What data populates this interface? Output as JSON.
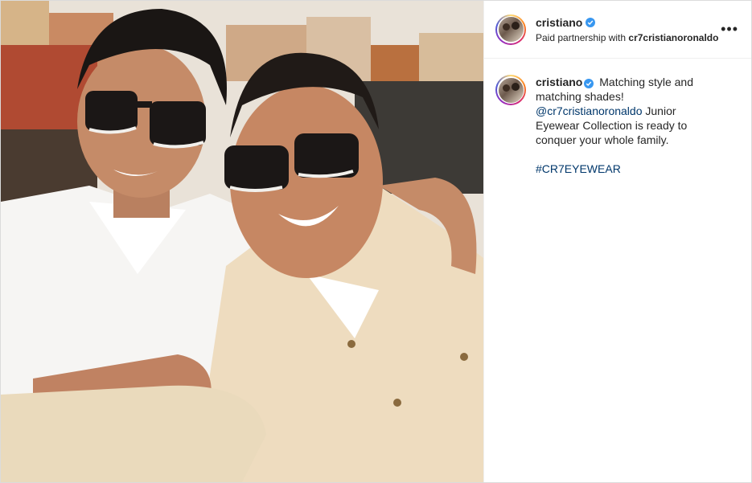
{
  "post": {
    "username": "cristiano",
    "partnership_prefix": "Paid partnership with ",
    "partner_account": "cr7cristianoronaldo",
    "more_glyph": "•••"
  },
  "caption": {
    "username": "cristiano",
    "text_1": "Matching style and matching shades!",
    "mention": "@cr7cristianoronaldo",
    "text_2": "Junior Eyewear Collection is ready to conquer your whole family.",
    "hashtag": "#CR7EYEWEAR"
  },
  "icons": {
    "verified": "verified-badge-icon",
    "more": "more-options-icon"
  },
  "colors": {
    "link": "#00376b",
    "verified": "#3897f0",
    "text": "#262626",
    "border": "#dbdbdb"
  }
}
